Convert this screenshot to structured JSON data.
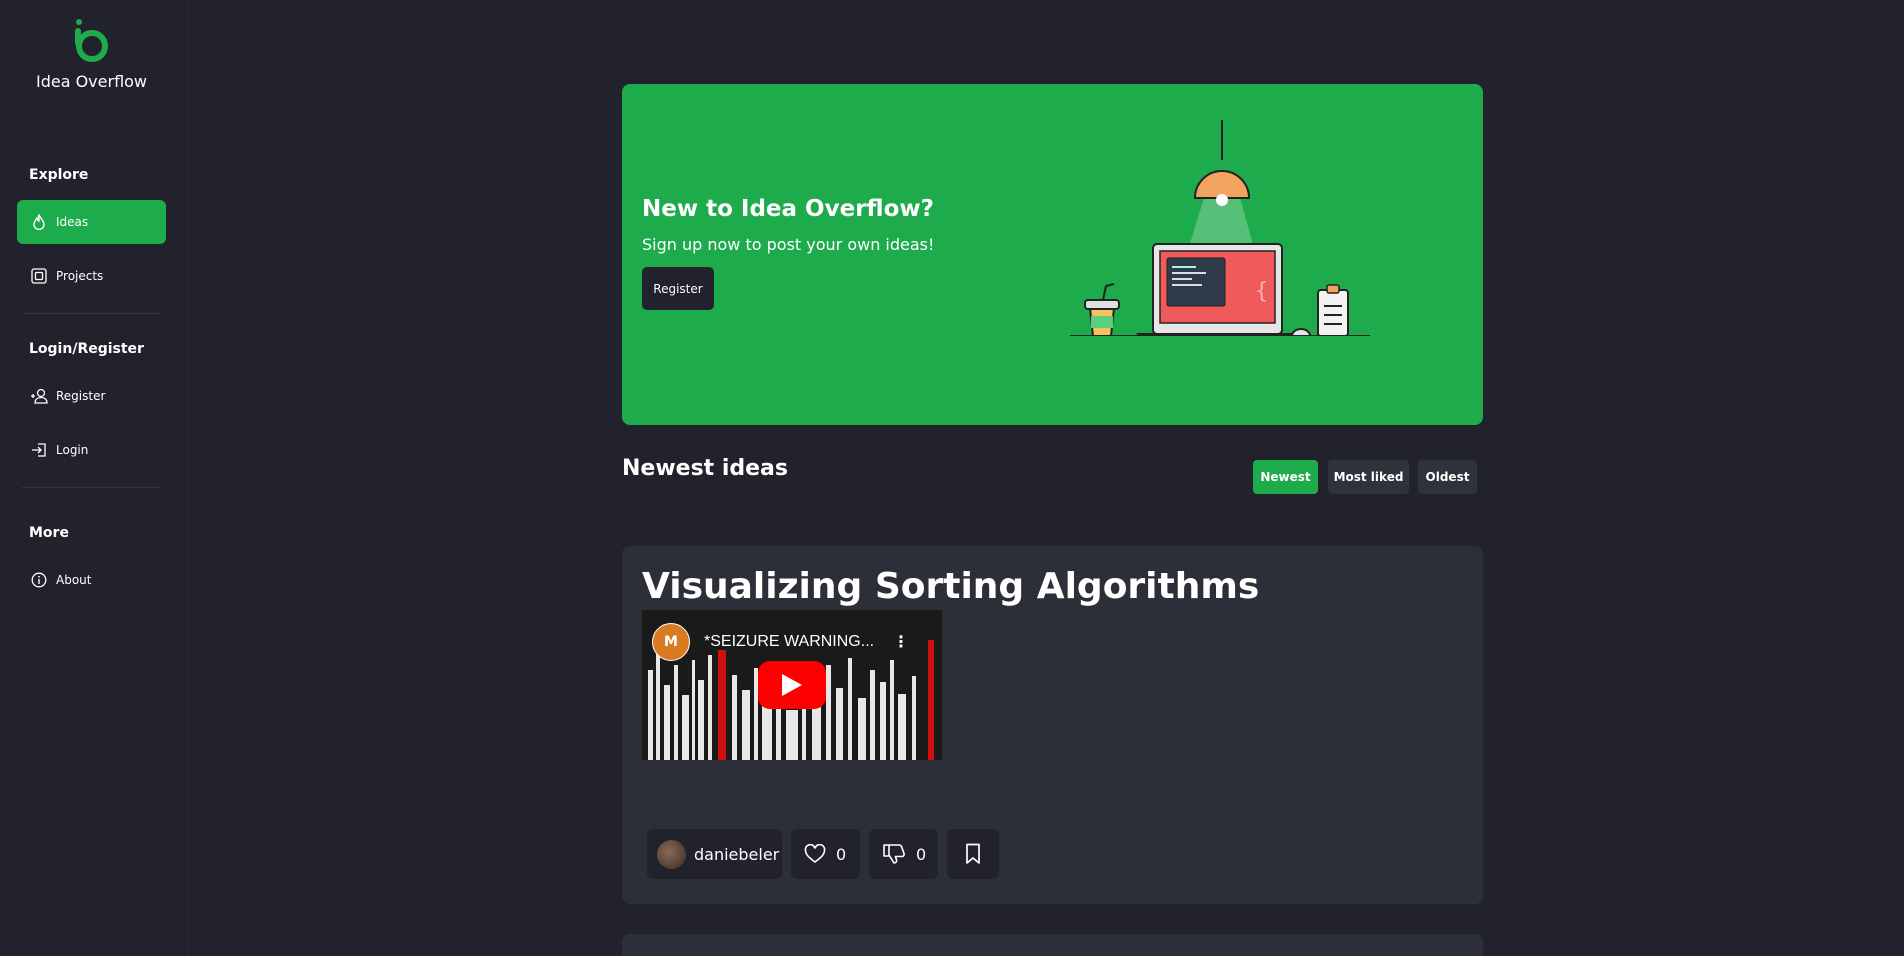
{
  "app": {
    "name": "Idea Overflow",
    "accent": "#1eab4b"
  },
  "sidebar": {
    "sections": [
      {
        "title": "Explore",
        "items": [
          {
            "label": "Ideas",
            "icon": "flame-icon",
            "active": true
          },
          {
            "label": "Projects",
            "icon": "chip-icon",
            "active": false
          }
        ]
      },
      {
        "title": "Login/Register",
        "items": [
          {
            "label": "Register",
            "icon": "user-plus-icon"
          },
          {
            "label": "Login",
            "icon": "login-icon"
          }
        ]
      },
      {
        "title": "More",
        "items": [
          {
            "label": "About",
            "icon": "info-icon"
          }
        ]
      }
    ]
  },
  "hero": {
    "title": "New to Idea Overflow?",
    "subtitle": "Sign up now to post your own ideas!",
    "button": "Register"
  },
  "feed": {
    "heading": "Newest ideas",
    "sort_options": [
      {
        "label": "Newest",
        "active": true
      },
      {
        "label": "Most liked"
      },
      {
        "label": "Oldest"
      }
    ],
    "ideas": [
      {
        "title": "Visualizing Sorting Algorithms",
        "video": {
          "title": "*SEIZURE WARNING...",
          "channel_initials": "M"
        },
        "author": "daniebeler",
        "likes": "0",
        "dislikes": "0"
      }
    ]
  }
}
